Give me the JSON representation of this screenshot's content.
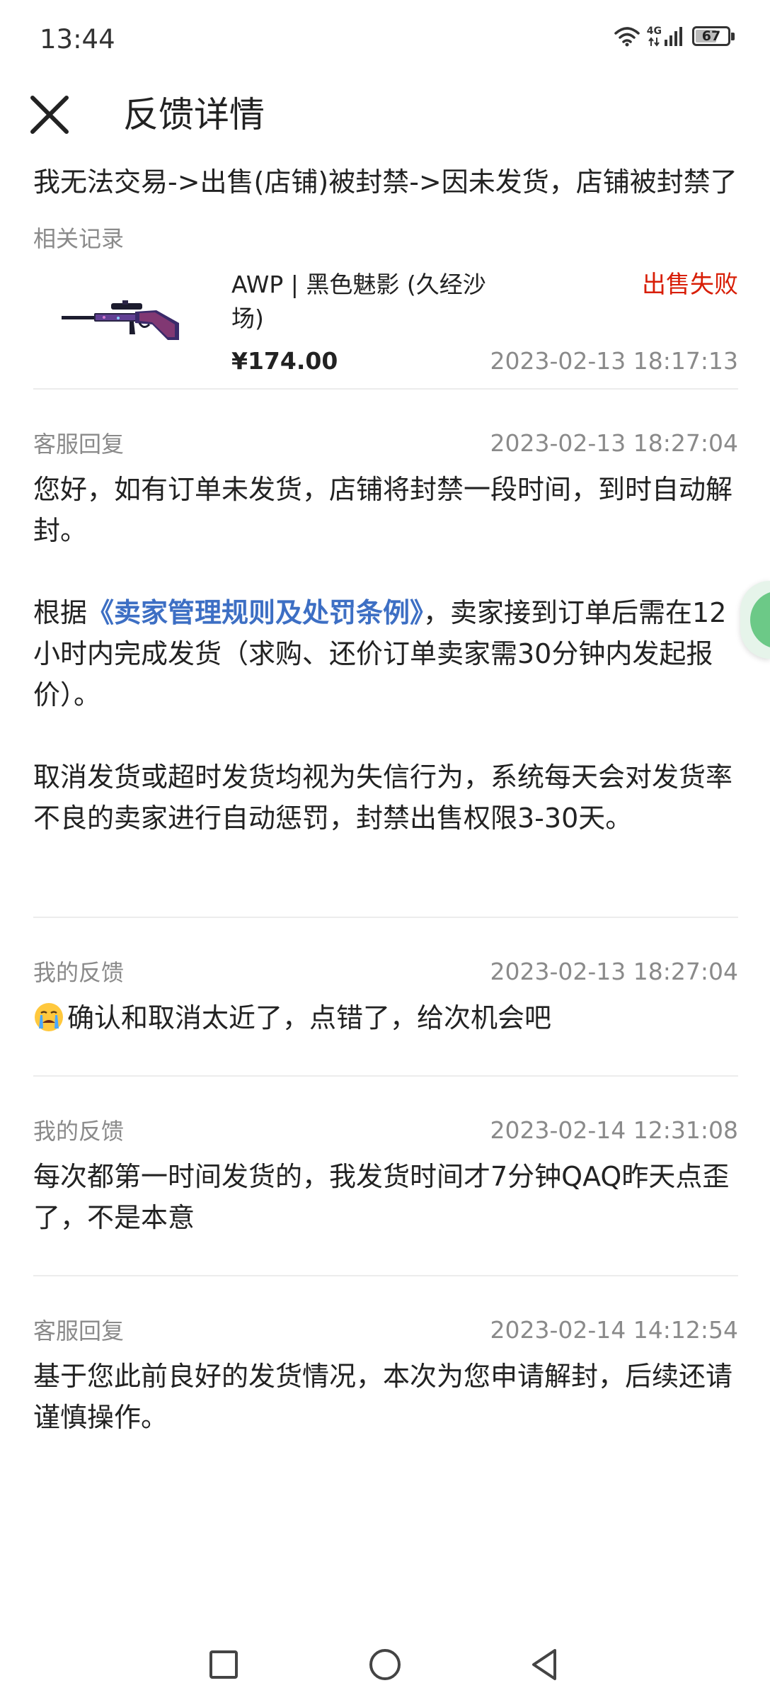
{
  "status_bar": {
    "time": "13:44",
    "network": "4G",
    "battery": "67",
    "battery_level": 0.67
  },
  "header": {
    "title": "反馈详情",
    "close_icon": "close-icon"
  },
  "topic": "我无法交易->出售(店铺)被封禁->因未发货，店铺被封禁了",
  "related": {
    "label": "相关记录",
    "item": {
      "name": "AWP | 黑色魅影 (久经沙场)",
      "price": "¥174.00",
      "status": "出售失败",
      "time": "2023-02-13 18:17:13",
      "image_icon": "awp-rifle-image"
    }
  },
  "messages": [
    {
      "author": "客服回复",
      "time": "2023-02-13 18:27:04",
      "p1": "您好，如有订单未发货，店铺将封禁一段时间，到时自动解封。",
      "p2_prefix": "根据",
      "p2_link": "《卖家管理规则及处罚条例》",
      "p2_suffix": "，卖家接到订单后需在12小时内完成发货（求购、还价订单卖家需30分钟内发起报价）。",
      "p3": "取消发货或超时发货均视为失信行为，系统每天会对发货率不良的卖家进行自动惩罚，封禁出售权限3-30天。"
    },
    {
      "author": "我的反馈",
      "time": "2023-02-13 18:27:04",
      "text": "确认和取消太近了，点错了，给次机会吧",
      "emoji": "crying-face-icon"
    },
    {
      "author": "我的反馈",
      "time": "2023-02-14 12:31:08",
      "text": "每次都第一时间发货的，我发货时间才7分钟QAQ昨天点歪了，不是本意"
    },
    {
      "author": "客服回复",
      "time": "2023-02-14 14:12:54",
      "text": "基于您此前良好的发货情况，本次为您申请解封，后续还请谨慎操作。"
    }
  ],
  "colors": {
    "status_fail": "#d81e06",
    "link": "#3d6fc4",
    "gray_text": "#8a8a8a",
    "divider": "#ececec"
  },
  "navbar": {
    "recents_icon": "square-recents-icon",
    "home_icon": "circle-home-icon",
    "back_icon": "triangle-back-icon"
  }
}
